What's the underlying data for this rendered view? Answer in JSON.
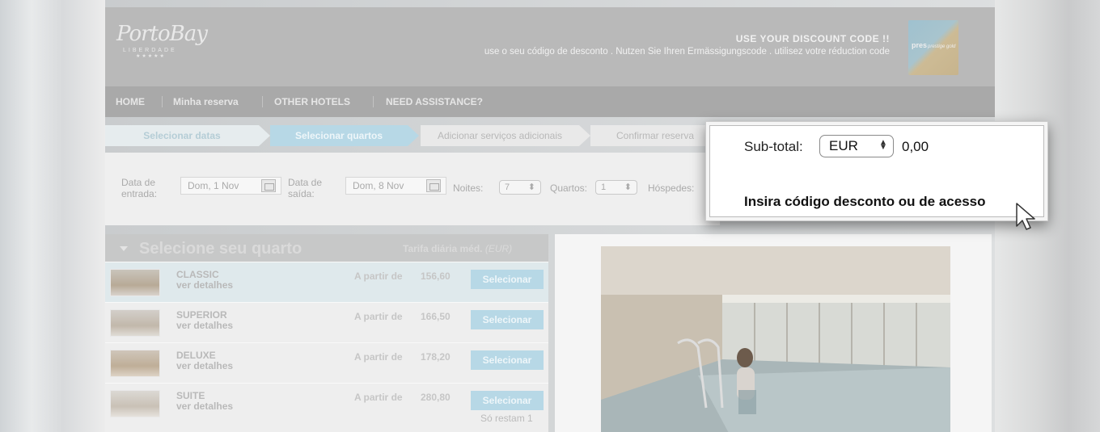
{
  "header": {
    "logo": {
      "name": "PortoBay",
      "subtitle": "LIBERDADE",
      "stars": "★★★★★"
    },
    "promo_title": "USE YOUR DISCOUNT CODE !!",
    "promo_sub": "use o seu código de desconto . Nutzen Sie Ihren Ermässigungscode . utilisez votre réduction code",
    "card_text_1": "pres",
    "card_text_2": "prestige gold"
  },
  "nav": {
    "items": [
      {
        "label": "HOME"
      },
      {
        "label": "Minha reserva"
      },
      {
        "label": "OTHER HOTELS"
      },
      {
        "label": "NEED ASSISTANCE?"
      }
    ]
  },
  "steps": [
    {
      "label": "Selecionar datas"
    },
    {
      "label": "Selecionar quartos"
    },
    {
      "label": "Adicionar serviços adicionais"
    },
    {
      "label": "Confirmar reserva"
    }
  ],
  "search": {
    "checkin_label_1": "Data de",
    "checkin_label_2": "entrada:",
    "checkin_value": "Dom, 1 Nov",
    "checkout_label_1": "Data de",
    "checkout_label_2": "saída:",
    "checkout_value": "Dom, 8 Nov",
    "nights_label": "Noites:",
    "nights_value": "7",
    "rooms_label": "Quartos:",
    "rooms_value": "1",
    "guests_label": "Hóspedes:"
  },
  "rooms": {
    "title": "Selecione seu quarto",
    "rate_label": "Tarifa diária méd.",
    "rate_currency": "(EUR)",
    "from_label": "A partir de",
    "details_label": "ver detalhes",
    "select_label": "Selecionar",
    "items": [
      {
        "name": "CLASSIC",
        "price": "156,60"
      },
      {
        "name": "SUPERIOR",
        "price": "166,50"
      },
      {
        "name": "DELUXE",
        "price": "178,20"
      },
      {
        "name": "SUITE",
        "price": "280,80",
        "note": "Só restam 1"
      }
    ]
  },
  "popup": {
    "subtotal_label": "Sub-total:",
    "currency": "EUR",
    "amount": "0,00",
    "discount_label": "Insira código desconto ou de acesso"
  },
  "colors": {
    "accent": "#b7d8e6",
    "header": "#b9b9b9",
    "nav": "#a9a9a9"
  }
}
